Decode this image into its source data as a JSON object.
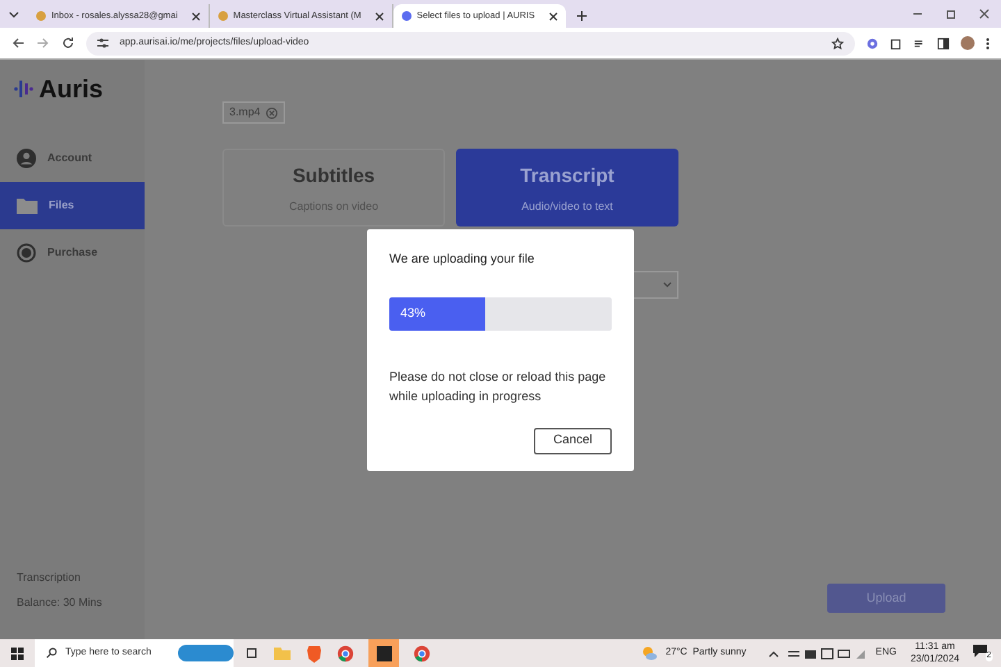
{
  "browser": {
    "tabs": [
      {
        "label": "Inbox - rosales.alyssa28@gmai",
        "selected": false
      },
      {
        "label": "Masterclass Virtual Assistant (M",
        "selected": false
      },
      {
        "label": "Select files to upload | AURIS",
        "selected": true
      }
    ],
    "url": "app.aurisai.io/me/projects/files/upload-video"
  },
  "app": {
    "logo": "Auris",
    "sidebar": {
      "items": [
        {
          "label": "Account",
          "selected": false
        },
        {
          "label": "Files",
          "selected": true
        },
        {
          "label": "Purchase",
          "selected": false
        }
      ],
      "footer": [
        "Transcription",
        "Balance: 30 Mins"
      ]
    },
    "file_chip": "3.mp4",
    "modes": [
      {
        "title": "Subtitles",
        "subtitle": "Captions on video",
        "selected": false
      },
      {
        "title": "Transcript",
        "subtitle": "Audio/video to text",
        "selected": true
      }
    ],
    "upload_button": "Upload"
  },
  "dialog": {
    "title": "We are uploading your file",
    "progress": {
      "level": 0.43,
      "label": "43%"
    },
    "message": "Please do not close or reload this page while uploading in progress",
    "cancel": "Cancel"
  },
  "taskbar": {
    "search_placeholder": "Type here to search",
    "weather": "27°C  Partly sunny",
    "language": "ENG",
    "time": "11:31 am",
    "date": "23/01/2024",
    "notifications": "2"
  }
}
